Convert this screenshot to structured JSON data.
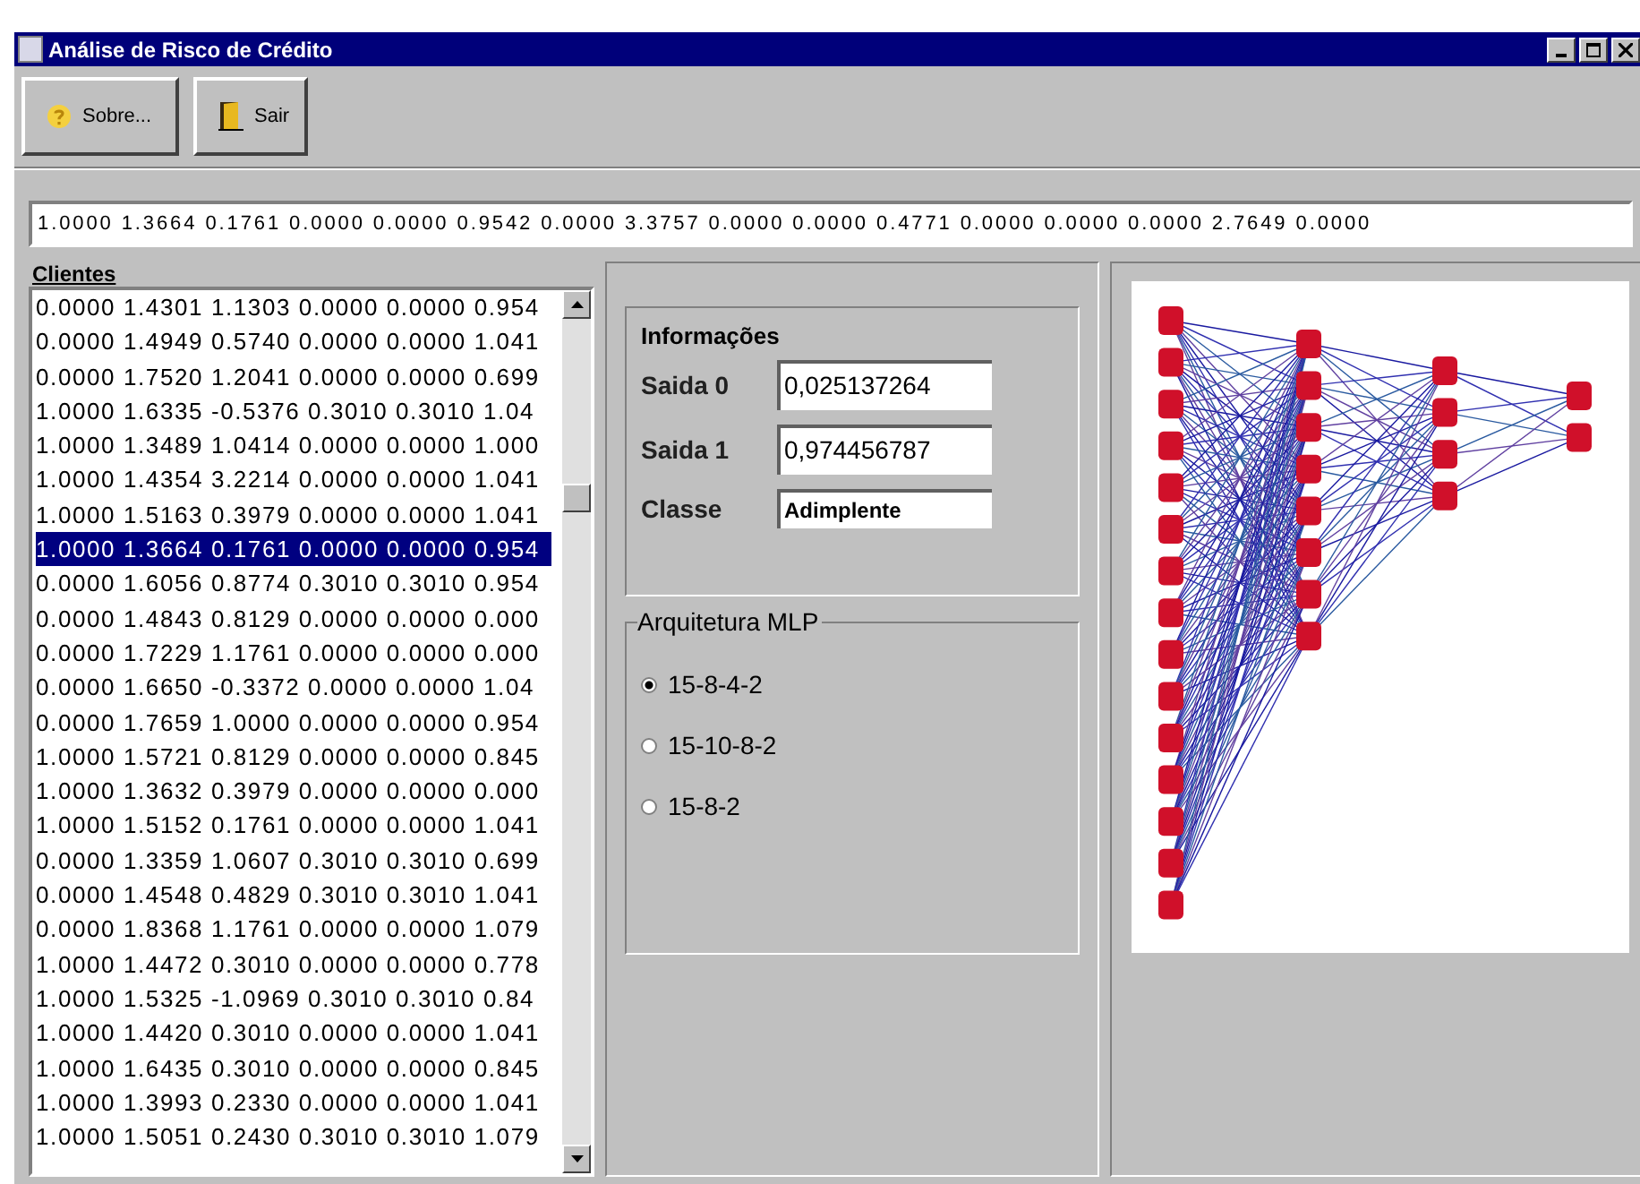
{
  "window": {
    "title": "Análise de Risco de Crédito"
  },
  "toolbar": [
    {
      "label": "Sobre..."
    },
    {
      "label": "Sair"
    }
  ],
  "input_vector": {
    "value": "1.0000 1.3664 0.1761 0.0000 0.0000 0.9542 0.0000 3.3757 0.0000 0.0000 0.4771 0.0000 0.0000 0.0000 2.7649 0.0000"
  },
  "clients": {
    "title": "Clientes",
    "rows": [
      {
        "text": "0.0000 1.4301 1.1303 0.0000 0.0000 0.954",
        "selected": false
      },
      {
        "text": "0.0000 1.4949 0.5740 0.0000 0.0000 1.041",
        "selected": false
      },
      {
        "text": "0.0000 1.7520 1.2041 0.0000 0.0000 0.699",
        "selected": false
      },
      {
        "text": "1.0000 1.6335 -0.5376 0.3010 0.3010 1.04",
        "selected": false
      },
      {
        "text": "1.0000 1.3489 1.0414 0.0000 0.0000 1.000",
        "selected": false
      },
      {
        "text": "1.0000 1.4354 3.2214 0.0000 0.0000 1.041",
        "selected": false
      },
      {
        "text": "1.0000 1.5163 0.3979 0.0000 0.0000 1.041",
        "selected": false
      },
      {
        "text": "1.0000 1.3664 0.1761 0.0000 0.0000 0.954",
        "selected": true
      },
      {
        "text": "0.0000 1.6056 0.8774 0.3010 0.3010 0.954",
        "selected": false
      },
      {
        "text": "0.0000 1.4843 0.8129 0.0000 0.0000 0.000",
        "selected": false
      },
      {
        "text": "0.0000 1.7229 1.1761 0.0000 0.0000 0.000",
        "selected": false
      },
      {
        "text": "0.0000 1.6650 -0.3372 0.0000 0.0000 1.04",
        "selected": false
      },
      {
        "text": "0.0000 1.7659 1.0000 0.0000 0.0000 0.954",
        "selected": false
      },
      {
        "text": "1.0000 1.5721 0.8129 0.0000 0.0000 0.845",
        "selected": false
      },
      {
        "text": "1.0000 1.3632 0.3979 0.0000 0.0000 0.000",
        "selected": false
      },
      {
        "text": "1.0000 1.5152 0.1761 0.0000 0.0000 1.041",
        "selected": false
      },
      {
        "text": "0.0000 1.3359 1.0607 0.3010 0.3010 0.699",
        "selected": false
      },
      {
        "text": "0.0000 1.4548 0.4829 0.3010 0.3010 1.041",
        "selected": false
      },
      {
        "text": "0.0000 1.8368 1.1761 0.0000 0.0000 1.079",
        "selected": false
      },
      {
        "text": "1.0000 1.4472 0.3010 0.0000 0.0000 0.778",
        "selected": false
      },
      {
        "text": "1.0000 1.5325 -1.0969 0.3010 0.3010 0.84",
        "selected": false
      },
      {
        "text": "1.0000 1.4420 0.3010 0.0000 0.0000 1.041",
        "selected": false
      },
      {
        "text": "1.0000 1.6435 0.3010 0.0000 0.0000 0.845",
        "selected": false
      },
      {
        "text": "1.0000 1.3993 0.2330 0.0000 0.0000 1.041",
        "selected": false
      },
      {
        "text": "1.0000 1.5051 0.2430 0.3010 0.3010 1.079",
        "selected": false
      }
    ]
  },
  "info": {
    "title": "Informações",
    "fields": [
      {
        "label": "Saida 0",
        "value": "0,025137264"
      },
      {
        "label": "Saida 1",
        "value": "0,974456787"
      },
      {
        "label": "Classe",
        "value": "Adimplente"
      }
    ]
  },
  "architecture": {
    "title": "Arquitetura MLP",
    "options": [
      {
        "label": "15-8-4-2",
        "selected": true
      },
      {
        "label": "15-10-8-2",
        "selected": false
      },
      {
        "label": "15-8-2",
        "selected": false
      }
    ]
  }
}
